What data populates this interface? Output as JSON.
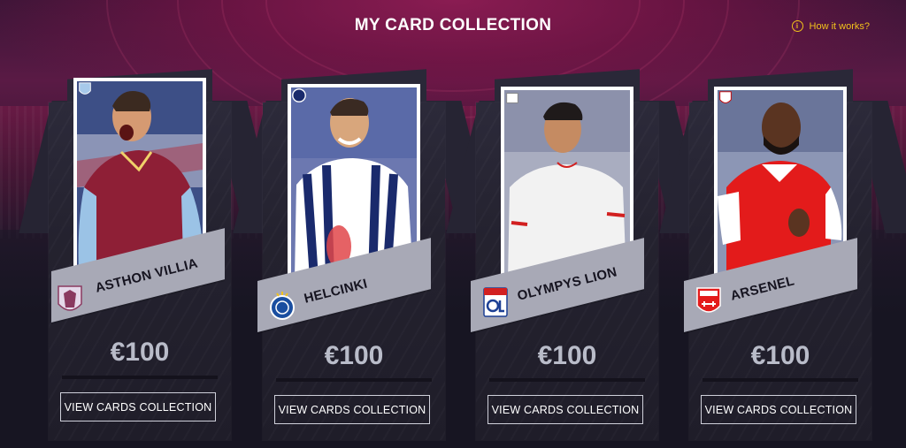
{
  "page": {
    "title": "MY CARD COLLECTION",
    "how_it_works": "How it works?",
    "info_icon": "info-circle-icon",
    "accent_color": "#f2c21b"
  },
  "cards": [
    {
      "club": "ASTHON VILLIA",
      "price": "€100",
      "button": "VIEW CARDS COLLECTION",
      "crest": "aston-villa-crest-icon",
      "kit_primary": "#8e1f36",
      "kit_secondary": "#9bc3e6"
    },
    {
      "club": "HELCINKI",
      "price": "€100",
      "button": "VIEW CARDS COLLECTION",
      "crest": "hjk-crest-icon",
      "kit_primary": "#1a2a6c",
      "kit_secondary": "#ffffff"
    },
    {
      "club": "OLYMPYS LION",
      "price": "€100",
      "button": "VIEW CARDS COLLECTION",
      "crest": "olympique-lyonnais-crest-icon",
      "kit_primary": "#f2f2f2",
      "kit_secondary": "#d22020"
    },
    {
      "club": "ARSENEL",
      "price": "€100",
      "button": "VIEW CARDS COLLECTION",
      "crest": "arsenal-crest-icon",
      "kit_primary": "#e31b1b",
      "kit_secondary": "#ffffff"
    }
  ]
}
